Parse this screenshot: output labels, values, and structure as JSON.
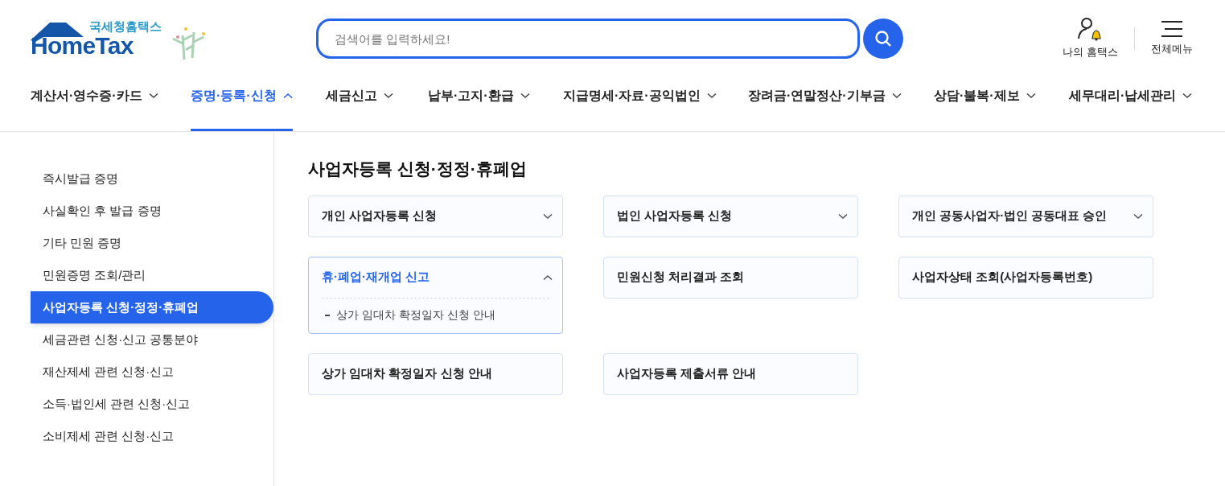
{
  "logo": {
    "subtitle": "국세청홈택스",
    "title": "HomeTax"
  },
  "search": {
    "placeholder": "검색어를 입력하세요!"
  },
  "utility": [
    {
      "kind": "myhome",
      "label": "나의 홈택스"
    },
    {
      "kind": "menu",
      "label": "전체메뉴"
    }
  ],
  "nav": [
    {
      "label": "계산서·영수증·카드",
      "selected": false
    },
    {
      "label": "증명·등록·신청",
      "selected": true
    },
    {
      "label": "세금신고",
      "selected": false
    },
    {
      "label": "납부·고지·환급",
      "selected": false
    },
    {
      "label": "지급명세·자료·공익법인",
      "selected": false
    },
    {
      "label": "장려금·연말정산·기부금",
      "selected": false
    },
    {
      "label": "상담·불복·제보",
      "selected": false
    },
    {
      "label": "세무대리·납세관리",
      "selected": false
    }
  ],
  "sidebar": {
    "items": [
      {
        "label": "즉시발급 증명",
        "selected": false
      },
      {
        "label": "사실확인 후 발급 증명",
        "selected": false
      },
      {
        "label": "기타 민원 증명",
        "selected": false
      },
      {
        "label": "민원증명 조회/관리",
        "selected": false
      },
      {
        "label": "사업자등록 신청·정정·휴폐업",
        "selected": true
      },
      {
        "label": "세금관련 신청·신고 공통분야",
        "selected": false
      },
      {
        "label": "재산제세 관련 신청·신고",
        "selected": false
      },
      {
        "label": "소득·법인세 관련 신청·신고",
        "selected": false
      },
      {
        "label": "소비제세 관련 신청·신고",
        "selected": false
      }
    ]
  },
  "main": {
    "title": "사업자등록 신청·정정·휴폐업",
    "cards": [
      {
        "kind": "accordion",
        "label": "개인 사업자등록 신청",
        "expanded": false
      },
      {
        "kind": "accordion",
        "label": "법인 사업자등록 신청",
        "expanded": false
      },
      {
        "kind": "accordion",
        "label": "개인 공동사업자·법인 공동대표 승인",
        "expanded": false
      },
      {
        "kind": "accordion",
        "label": "휴·폐업·재개업 신고",
        "expanded": true,
        "children": [
          "상가 임대차 확정일자 신청 안내"
        ]
      },
      {
        "kind": "link",
        "label": "민원신청 처리결과 조회"
      },
      {
        "kind": "link",
        "label": "사업자상태 조회(사업자등록번호)"
      },
      {
        "kind": "link",
        "label": "상가 임대차 확정일자 신청 안내"
      },
      {
        "kind": "link",
        "label": "사업자등록 제출서류 안내"
      }
    ]
  }
}
